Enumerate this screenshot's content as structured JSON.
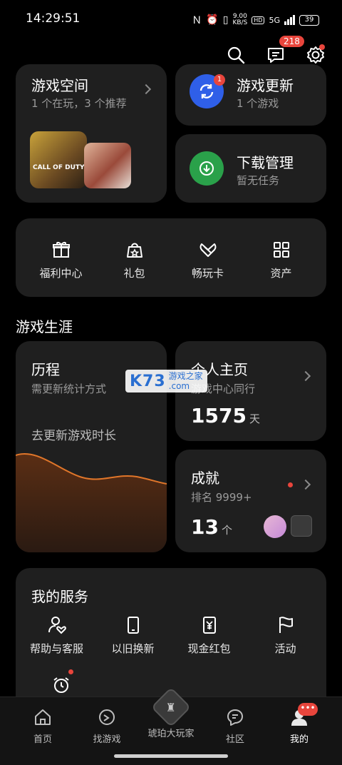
{
  "status": {
    "time": "14:29:51",
    "net_speed": "9.00",
    "net_unit": "KB/S",
    "hd": "HD",
    "network": "5G",
    "battery": "39"
  },
  "header": {
    "message_badge": "218"
  },
  "game_space": {
    "title": "游戏空间",
    "subtitle": "1 个在玩，3 个推荐",
    "thumb_label": "CALL OF DUTY"
  },
  "game_update": {
    "title": "游戏更新",
    "subtitle": "1 个游戏",
    "badge": "1"
  },
  "download": {
    "title": "下载管理",
    "subtitle": "暂无任务"
  },
  "quick": {
    "items": [
      {
        "label": "福利中心",
        "icon": "gift-icon"
      },
      {
        "label": "礼包",
        "icon": "gift-bag-icon"
      },
      {
        "label": "畅玩卡",
        "icon": "card-icon"
      },
      {
        "label": "资产",
        "icon": "grid-icon"
      }
    ]
  },
  "career": {
    "section_title": "游戏生涯",
    "history": {
      "title": "历程",
      "subtitle": "需更新统计方式",
      "prompt": "去更新游戏时长"
    },
    "profile": {
      "title": "个人主页",
      "subtitle": "游戏中心同行",
      "days": "1575",
      "unit": "天"
    },
    "achievement": {
      "title": "成就",
      "subtitle": "排名 9999+",
      "count": "13",
      "unit": "个"
    }
  },
  "services": {
    "title": "我的服务",
    "items": [
      {
        "label": "帮助与客服",
        "icon": "support-icon"
      },
      {
        "label": "以旧换新",
        "icon": "phone-icon"
      },
      {
        "label": "现金红包",
        "icon": "red-envelope-icon"
      },
      {
        "label": "活动",
        "icon": "flag-icon"
      }
    ]
  },
  "watermark": {
    "brand": "K73",
    "text1": "游戏之家",
    "text2": ".com"
  },
  "nav": {
    "items": [
      {
        "label": "首页",
        "icon": "home-icon"
      },
      {
        "label": "找游戏",
        "icon": "find-game-icon"
      },
      {
        "label": "琥珀大玩家",
        "icon": "amber-player-icon"
      },
      {
        "label": "社区",
        "icon": "community-icon"
      },
      {
        "label": "我的",
        "icon": "profile-icon",
        "active": true
      }
    ]
  },
  "colors": {
    "accent_red": "#e8453c",
    "update_blue": "#2f5fe8",
    "download_green": "#2aa14a",
    "chart_orange": "#e0762a"
  }
}
